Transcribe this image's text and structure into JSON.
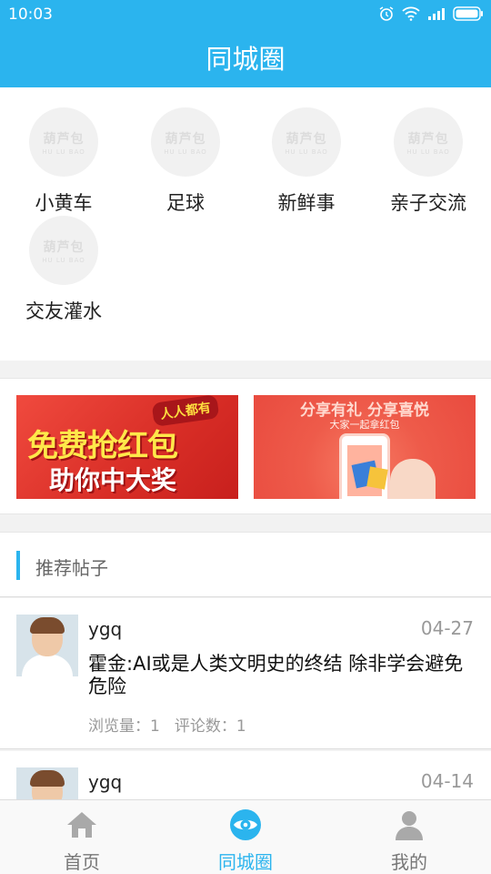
{
  "status": {
    "time": "10:03"
  },
  "header": {
    "title": "同城圈"
  },
  "placeholder_logo": {
    "cn": "葫芦包",
    "en": "HU LU BAO"
  },
  "categories": [
    {
      "label": "小黄车"
    },
    {
      "label": "足球"
    },
    {
      "label": "新鲜事"
    },
    {
      "label": "亲子交流"
    },
    {
      "label": "交友灌水"
    }
  ],
  "banners": [
    {
      "tag": "人人都有",
      "line1": "免费抢红包",
      "line2": "助你中大奖"
    },
    {
      "headline": "分享有礼  分享喜悦",
      "sub": "大家一起拿红包"
    }
  ],
  "section": {
    "title": "推荐帖子"
  },
  "posts": [
    {
      "user": "ygq",
      "date": "04-27",
      "title": "霍金:AI或是人类文明史的终结 除非学会避免危险",
      "views_label": "浏览量：1",
      "comments_label": "评论数：1"
    },
    {
      "user": "ygq",
      "date": "04-14"
    }
  ],
  "tabs": [
    {
      "label": "首页",
      "icon": "home-icon",
      "active": false
    },
    {
      "label": "同城圈",
      "icon": "eye-icon",
      "active": true
    },
    {
      "label": "我的",
      "icon": "user-icon",
      "active": false
    }
  ],
  "colors": {
    "accent": "#2bb4ee",
    "banner_red": "#e94b3f"
  }
}
